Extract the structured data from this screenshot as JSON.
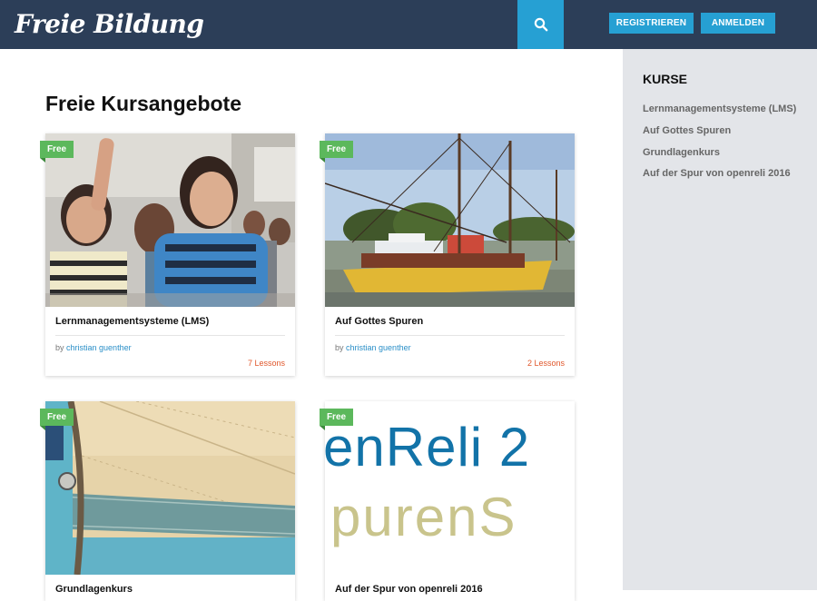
{
  "header": {
    "logo": "Freie Bildung",
    "register_label": "REGISTRIEREN",
    "login_label": "ANMELDEN"
  },
  "main": {
    "title": "Freie Kursangebote",
    "courses": [
      {
        "badge": "Free",
        "title": "Lernmanagementsysteme (LMS)",
        "by": "by",
        "author": "christian guenther",
        "lessons": "7 Lessons"
      },
      {
        "badge": "Free",
        "title": "Auf Gottes Spuren",
        "by": "by",
        "author": "christian guenther",
        "lessons": "2 Lessons"
      },
      {
        "badge": "Free",
        "title": "Grundlagenkurs"
      },
      {
        "badge": "Free",
        "title": "Auf der Spur von openreli 2016",
        "image_text_line1": "enReli 2",
        "image_text_line2": "purenS"
      }
    ]
  },
  "sidebar": {
    "title": "KURSE",
    "items": [
      {
        "label": "Lernmanagementsysteme (LMS)"
      },
      {
        "label": "Auf Gottes Spuren"
      },
      {
        "label": "Grundlagenkurs"
      },
      {
        "label": "Auf der Spur von openreli 2016"
      }
    ]
  },
  "colors": {
    "header_bg": "#2c3e58",
    "accent_blue": "#26a0d3",
    "badge_green": "#5cb85c",
    "lessons_orange": "#e0572b",
    "sidebar_bg": "#e3e5e9"
  }
}
